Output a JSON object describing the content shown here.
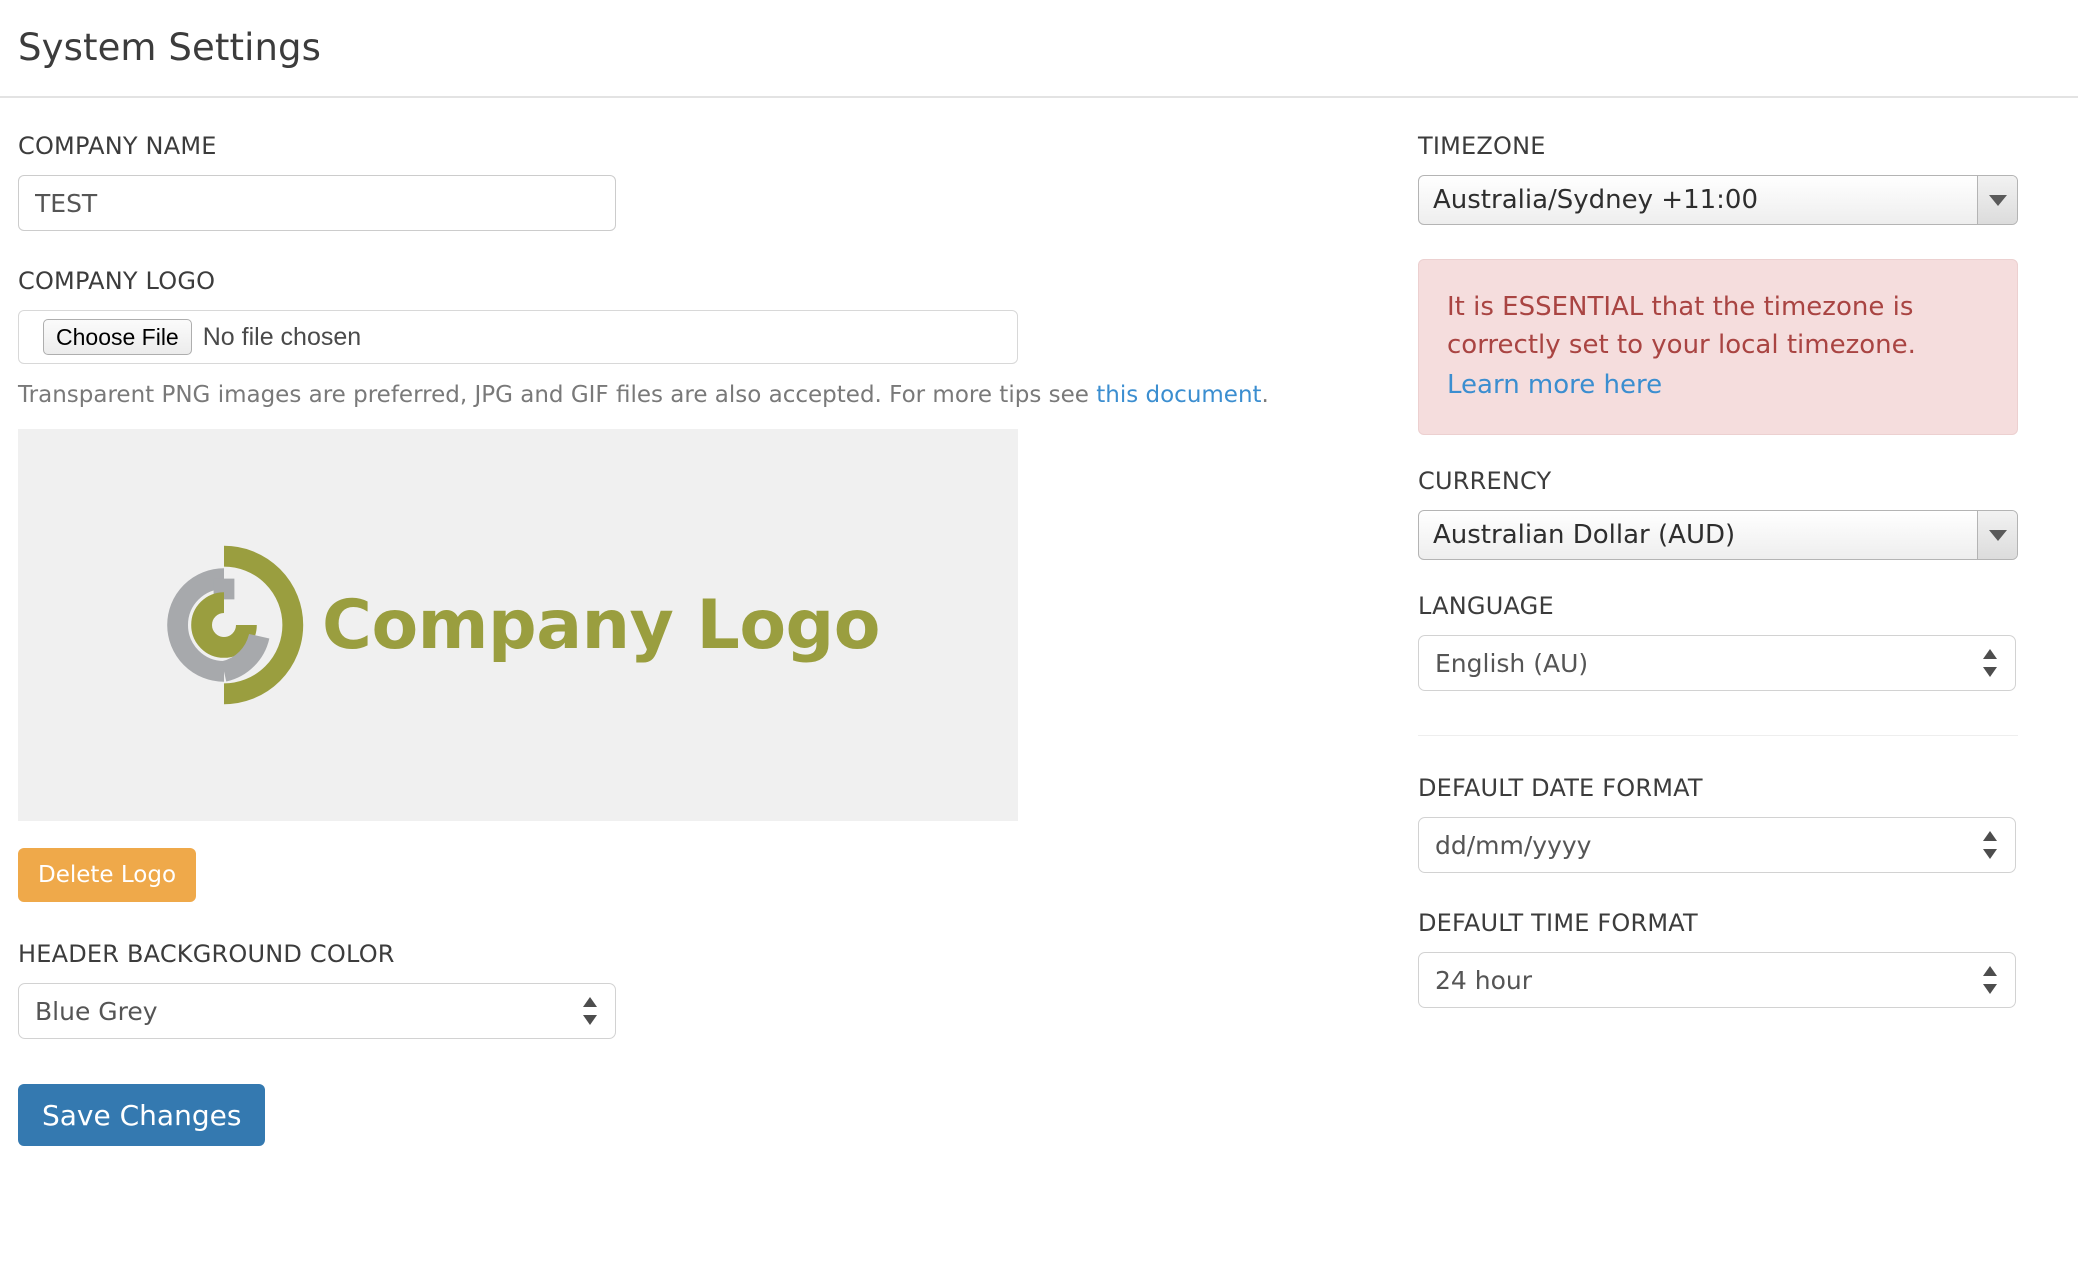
{
  "header": {
    "title": "System Settings"
  },
  "left": {
    "company_name": {
      "label": "COMPANY NAME",
      "value": "TEST",
      "placeholder": ""
    },
    "company_logo": {
      "label": "COMPANY LOGO",
      "choose_file_label": "Choose File",
      "file_name": "No file chosen",
      "help_text": "Transparent PNG images are preferred, JPG and GIF files are also accepted. For more tips see ",
      "help_link_text": "this document",
      "help_text_end": ".",
      "preview_alt": "Company Logo",
      "logo_wordmark": "Company Logo",
      "delete_button": "Delete Logo"
    },
    "header_background_color": {
      "label": "HEADER BACKGROUND COLOR",
      "value": "Blue Grey"
    },
    "save_button": "Save Changes"
  },
  "right": {
    "timezone": {
      "label": "TIMEZONE",
      "value": "Australia/Sydney +11:00"
    },
    "alert": {
      "text": "It is ESSENTIAL that the timezone is correctly set to your local timezone.",
      "link_text": "Learn more here"
    },
    "currency": {
      "label": "CURRENCY",
      "value": "Australian Dollar (AUD)"
    },
    "language": {
      "label": "LANGUAGE",
      "value": "English (AU)"
    },
    "date_format": {
      "label": "DEFAULT DATE FORMAT",
      "value": "dd/mm/yyyy"
    },
    "time_format": {
      "label": "DEFAULT TIME FORMAT",
      "value": "24 hour"
    }
  },
  "colors": {
    "accent_blue": "#3479b0",
    "warning_orange": "#efa94a",
    "alert_background": "#f5dddd",
    "alert_text": "#a94442",
    "link_blue": "#3b8ed0",
    "logo_olive": "#9a9e3f",
    "logo_grey": "#a7a9ac",
    "preview_background": "#f0f0f0"
  }
}
